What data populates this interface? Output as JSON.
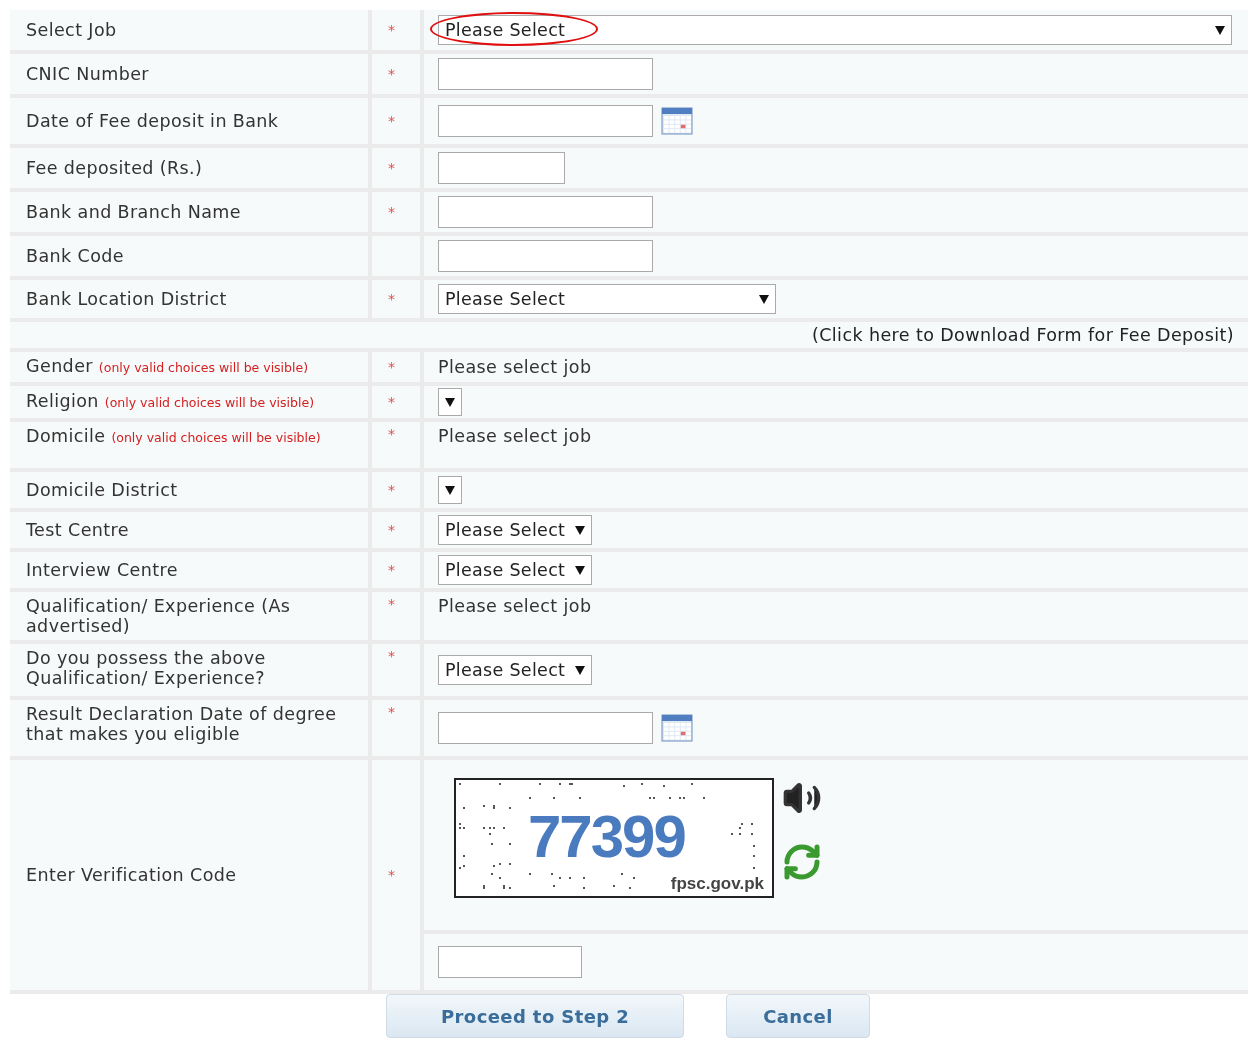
{
  "rows": [
    {
      "label": "Select Job",
      "mark": "*",
      "kind": "dropdown",
      "value": "Please Select",
      "circled": true
    },
    {
      "label": "CNIC Number",
      "mark": "*",
      "kind": "input"
    },
    {
      "label": "Date of Fee deposit in Bank",
      "mark": "*",
      "kind": "date"
    },
    {
      "label": "Fee deposited (Rs.)",
      "mark": "*",
      "kind": "input"
    },
    {
      "label": "Bank and Branch Name",
      "mark": "*",
      "kind": "input"
    },
    {
      "label": "Bank Code",
      "kind": "input"
    },
    {
      "label": "Bank Location District",
      "mark": "*",
      "kind": "dropdown",
      "value": "Please Select"
    },
    {
      "kind": "link",
      "text": "(Click here to Download Form for Fee Deposit)"
    },
    {
      "label": "Gender",
      "note": "(only valid choices will be visible)",
      "mark": "*",
      "kind": "text",
      "text": "Please select job"
    },
    {
      "label": "Religion",
      "note": "(only valid choices will be visible)",
      "mark": "*",
      "kind": "dropdown"
    },
    {
      "label": "Domicile",
      "note": "(only valid choices will be visible)",
      "mark": "*",
      "kind": "text",
      "text": "Please select job"
    },
    {
      "label": "Domicile District",
      "mark": "*",
      "kind": "dropdown"
    },
    {
      "label": "Test Centre",
      "mark": "*",
      "kind": "dropdown",
      "value": "Please Select"
    },
    {
      "label": "Interview Centre",
      "mark": "*",
      "kind": "dropdown",
      "value": "Please Select"
    },
    {
      "label": "Qualification/ Experience (As advertised)",
      "mark": "*",
      "kind": "text",
      "text": "Please select job"
    },
    {
      "label": "Do you possess the above Qualification/ Experience?",
      "mark": "*",
      "kind": "dropdown",
      "value": "Please Select"
    },
    {
      "label": "Result Declaration Date of degree that makes you eligible",
      "mark": "*",
      "kind": "date"
    },
    {
      "label": "Enter Verification Code",
      "mark": "*",
      "kind": "captcha",
      "code": "77399",
      "site": "fpsc.gov.pk"
    }
  ],
  "buttons": [
    {
      "label": "Proceed to Step 2"
    },
    {
      "label": "Cancel"
    }
  ]
}
